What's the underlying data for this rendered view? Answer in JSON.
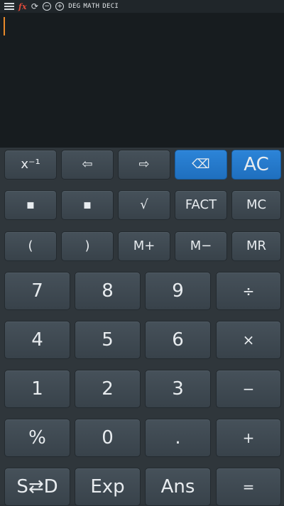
{
  "statusbar": {
    "icons": [
      "menu-icon",
      "fx-icon",
      "sync-icon",
      "minus-circle-icon",
      "plus-circle-icon"
    ],
    "fx_label": "fx",
    "modes": [
      "DEG",
      "MATH",
      "DECI"
    ]
  },
  "display": {
    "expression": ""
  },
  "keys": {
    "row1": [
      "x⁻¹",
      "⇦",
      "⇨",
      "⌫",
      "AC"
    ],
    "row2": [
      "▪",
      "▪",
      "√",
      "FACT",
      "MC"
    ],
    "row3": [
      "(",
      ")",
      "M+",
      "M−",
      "MR"
    ],
    "row4": [
      "7",
      "8",
      "9",
      "÷"
    ],
    "row5": [
      "4",
      "5",
      "6",
      "×"
    ],
    "row6": [
      "1",
      "2",
      "3",
      "−"
    ],
    "row7": [
      "%",
      "0",
      ".",
      "+"
    ],
    "row8": [
      "S⇄D",
      "Exp",
      "Ans",
      "="
    ]
  },
  "colors": {
    "accent_blue": "#2c84d8",
    "cursor": "#e88a2a",
    "fx_red": "#e04a3a"
  }
}
